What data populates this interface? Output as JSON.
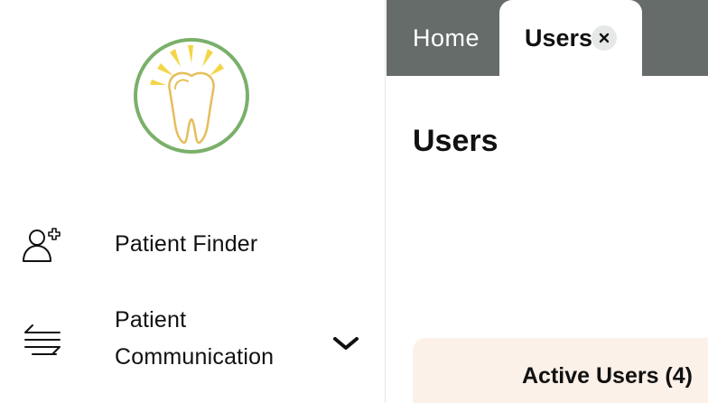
{
  "sidebar": {
    "logo_icon": "tooth-logo-icon",
    "items": [
      {
        "label": "Patient Finder",
        "icon": "user-plus-icon"
      },
      {
        "label": "Patient\nCommunication",
        "icon": "arrows-exchange-icon",
        "expand_icon": "chevron-down-icon"
      }
    ]
  },
  "tabs": [
    {
      "label": "Home",
      "active": false
    },
    {
      "label": "Users",
      "active": true,
      "close_icon": "close-icon"
    }
  ],
  "main": {
    "title": "Users",
    "card_title": "Active Users (4)"
  },
  "colors": {
    "tabbar_bg": "#656c6a",
    "logo_ring": "#7ab06a",
    "logo_rays": "#f3d548",
    "tooth_stroke": "#e6be5a",
    "card_bg": "#fcf1e8"
  }
}
